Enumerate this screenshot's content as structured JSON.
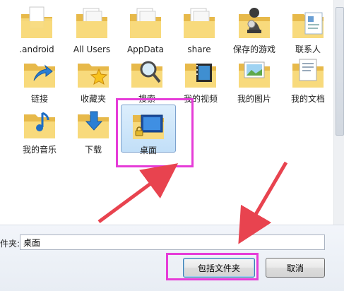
{
  "items": [
    {
      "label": ".android",
      "icon": "folder-icon"
    },
    {
      "label": "All Users",
      "icon": "folder-doc-icon"
    },
    {
      "label": "AppData",
      "icon": "folder-doc-icon"
    },
    {
      "label": "share",
      "icon": "folder-doc-icon"
    },
    {
      "label": "保存的游戏",
      "icon": "chess-folder-icon"
    },
    {
      "label": "联系人",
      "icon": "contacts-folder-icon"
    },
    {
      "label": "链接",
      "icon": "link-folder-icon"
    },
    {
      "label": "收藏夹",
      "icon": "star-folder-icon"
    },
    {
      "label": "搜索",
      "icon": "search-folder-icon"
    },
    {
      "label": "我的视频",
      "icon": "video-folder-icon"
    },
    {
      "label": "我的图片",
      "icon": "pictures-folder-icon"
    },
    {
      "label": "我的文档",
      "icon": "documents-folder-icon"
    },
    {
      "label": "我的音乐",
      "icon": "music-folder-icon"
    },
    {
      "label": "下载",
      "icon": "download-folder-icon"
    },
    {
      "label": "桌面",
      "icon": "desktop-folder-icon",
      "selected": true
    }
  ],
  "folder_field": {
    "label": "件夹:",
    "value": "桌面"
  },
  "buttons": {
    "include_folder": "包括文件夹",
    "cancel": "取消"
  },
  "colors": {
    "highlight": "#e63cd8",
    "arrow": "#e8434f",
    "folder": "#f2cf6a",
    "selection": "#c9e3f9"
  }
}
